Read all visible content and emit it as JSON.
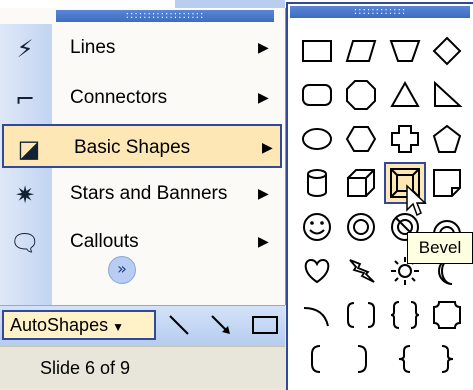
{
  "menu": {
    "items": [
      {
        "label": "Lines",
        "icon": "lines-icon"
      },
      {
        "label": "Connectors",
        "icon": "connectors-icon"
      },
      {
        "label": "Basic Shapes",
        "icon": "basic-shapes-icon",
        "selected": true
      },
      {
        "label": "Stars and Banners",
        "icon": "stars-banners-icon"
      },
      {
        "label": "Callouts",
        "icon": "callouts-icon"
      }
    ],
    "expand_icon": "chevron-double-down-icon"
  },
  "toolbar": {
    "autoshapes_label": "AutoShapes"
  },
  "status": {
    "text": "Slide 6 of 9"
  },
  "palette": {
    "hovered_shape": "Bevel",
    "tooltip": "Bevel"
  },
  "colors": {
    "highlight": "#fde7b4",
    "border": "#31499a",
    "title_bar": "#3d6cc0"
  }
}
